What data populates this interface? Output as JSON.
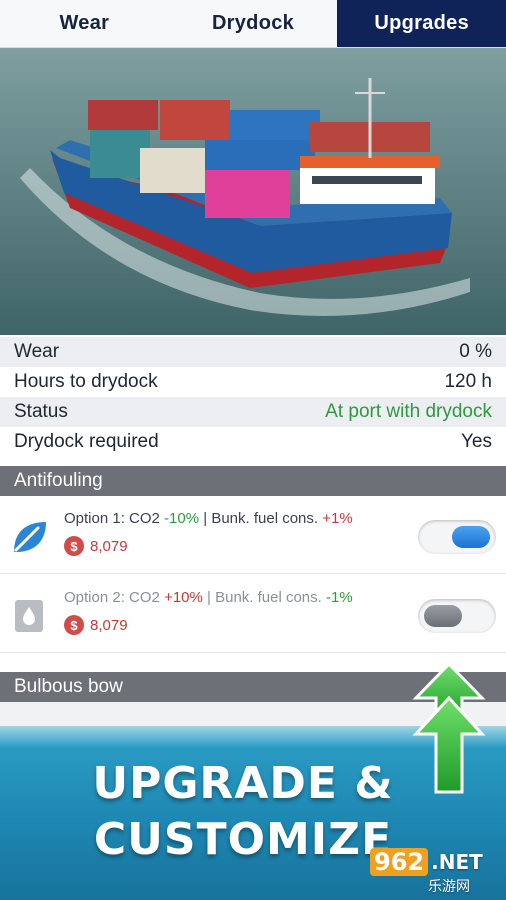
{
  "tabs": [
    {
      "label": "Wear",
      "active": false
    },
    {
      "label": "Drydock",
      "active": false
    },
    {
      "label": "Upgrades",
      "active": true
    }
  ],
  "hero": {
    "image": "container-ship-photo"
  },
  "info": {
    "wear_label": "Wear",
    "wear_value": "0 %",
    "hours_label": "Hours to drydock",
    "hours_value": "120 h",
    "status_label": "Status",
    "status_value": "At port with drydock",
    "drydock_label": "Drydock required",
    "drydock_value": "Yes"
  },
  "sections": {
    "antifouling": "Antifouling",
    "bulbous_bow": "Bulbous bow"
  },
  "options": [
    {
      "prefix": "Option 1: CO2 ",
      "co2_change": "-10%",
      "middle": " | Bunk. fuel cons. ",
      "fuel_change": "+1%",
      "price": "8,079",
      "enabled": true,
      "icon": "leaf-icon"
    },
    {
      "prefix": "Option 2: CO2 ",
      "co2_change": "+10%",
      "middle": " | Bunk. fuel cons. ",
      "fuel_change": "-1%",
      "price": "8,079",
      "enabled": false,
      "icon": "fuel-drop-icon"
    }
  ],
  "promo": {
    "line1": "UPGRADE &",
    "line2": "CUSTOMIZE"
  },
  "watermark": {
    "brand": "962",
    "tld": ".NET",
    "sub": "乐游网"
  },
  "colors": {
    "tab_active": "#0f2358",
    "positive": "#2f9a3d",
    "negative": "#c23a3a",
    "toggle_on": "#1c73d1",
    "section_bg": "#6d7077"
  }
}
